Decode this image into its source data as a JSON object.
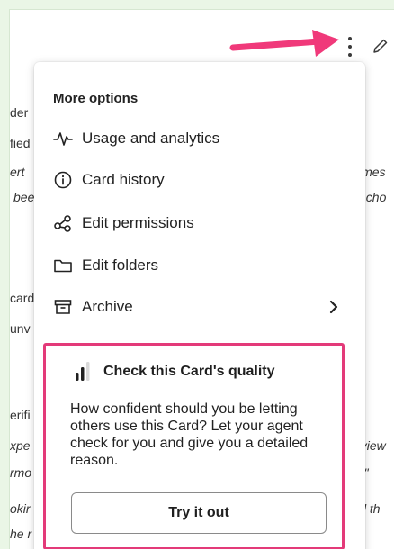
{
  "topbar": {
    "more_icon": "kebab-vertical-icon",
    "edit_icon": "pencil-icon",
    "annotation_arrow_color": "#f0397a"
  },
  "background_fragments": [
    {
      "text": "der",
      "style": "normal"
    },
    {
      "text": "fied",
      "style": "normal"
    },
    {
      "text": "ert",
      "style": "italic"
    },
    {
      "text": "bee",
      "style": "italic"
    },
    {
      "text": "imes",
      "style": "italic"
    },
    {
      "text": "t cho",
      "style": "italic"
    },
    {
      "text": "card",
      "style": "normal"
    },
    {
      "text": "unv",
      "style": "normal"
    },
    {
      "text": "erifi",
      "style": "normal"
    },
    {
      "text": "xpe",
      "style": "italic"
    },
    {
      "text": "rmo",
      "style": "italic"
    },
    {
      "text": "okir",
      "style": "italic"
    },
    {
      "text": "he r",
      "style": "italic"
    },
    {
      "text": "ı view",
      "style": "italic"
    },
    {
      "text": "g.\"",
      "style": "italic"
    },
    {
      "text": "lid th",
      "style": "italic"
    }
  ],
  "menu": {
    "title": "More options",
    "items": [
      {
        "label": "Usage and analytics",
        "icon": "activity-pulse-icon"
      },
      {
        "label": "Card history",
        "icon": "info-circle-icon"
      },
      {
        "label": "Edit permissions",
        "icon": "share-nodes-icon"
      },
      {
        "label": "Edit folders",
        "icon": "folder-icon"
      },
      {
        "label": "Archive",
        "icon": "archive-box-icon",
        "has_submenu": true
      }
    ]
  },
  "promo": {
    "title": "Check this Card's quality",
    "icon": "signal-bars-icon",
    "body": "How confident should you be letting others use this Card? Let your agent check for you and give you a detailed reason.",
    "button_label": "Try it out",
    "highlight_color": "#e33a79"
  }
}
